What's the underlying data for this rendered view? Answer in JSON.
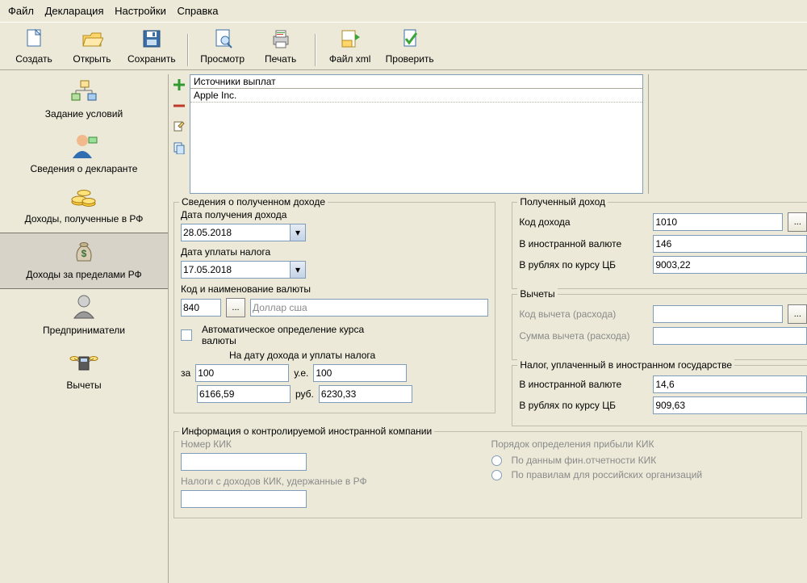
{
  "menu": {
    "file": "Файл",
    "decl": "Декларация",
    "settings": "Настройки",
    "help": "Справка"
  },
  "toolbar": {
    "create": "Создать",
    "open": "Открыть",
    "save": "Сохранить",
    "preview": "Просмотр",
    "print": "Печать",
    "xml": "Файл xml",
    "check": "Проверить"
  },
  "sidebar": {
    "conditions": "Задание условий",
    "declarant": "Сведения о декларанте",
    "income_rf": "Доходы, полученные в РФ",
    "income_abroad": "Доходы за пределами РФ",
    "entrepren": "Предприниматели",
    "deductions": "Вычеты"
  },
  "sources": {
    "header": "Источники выплат",
    "rows": [
      "Apple Inc."
    ]
  },
  "gb1": {
    "title": "Сведения о полученном доходе",
    "date_recv_label": "Дата получения дохода",
    "date_recv": "28.05.2018",
    "date_tax_label": "Дата уплаты налога",
    "date_tax": "17.05.2018",
    "currency_code_label": "Код и наименование валюты",
    "currency_code": "840",
    "currency_name": "Доллар сша",
    "auto_label": "Автоматическое определение курса валюты",
    "rate_header": "На дату дохода и уплаты налога",
    "za": "за",
    "ue": "у.е.",
    "rub": "руб.",
    "rate_for": "100",
    "rate_ue": "100",
    "rate_val1": "6166,59",
    "rate_val2": "6230,33"
  },
  "gb2": {
    "title": "Полученный доход",
    "code_label": "Код дохода",
    "code": "1010",
    "fx_label": "В иностранной валюте",
    "fx": "146",
    "rub_label": "В рублях по курсу ЦБ",
    "rub": "9003,22"
  },
  "gb3": {
    "title": "Вычеты",
    "code_label": "Код вычета (расхода)",
    "sum_label": "Сумма вычета (расхода)"
  },
  "gb4": {
    "title": "Налог, уплаченный в иностранном государстве",
    "fx_label": "В иностранной валюте",
    "fx": "14,6",
    "rub_label": "В рублях по курсу ЦБ",
    "rub": "909,63"
  },
  "gb5": {
    "title": "Информация о контролируемой иностранной компании",
    "num_label": "Номер КИК",
    "tax_label": "Налоги с доходов КИК, удержанные в РФ",
    "order_label": "Порядок определения прибыли КИК",
    "opt1": "По данным фин.отчетности КИК",
    "opt2": "По правилам для российских организаций"
  }
}
